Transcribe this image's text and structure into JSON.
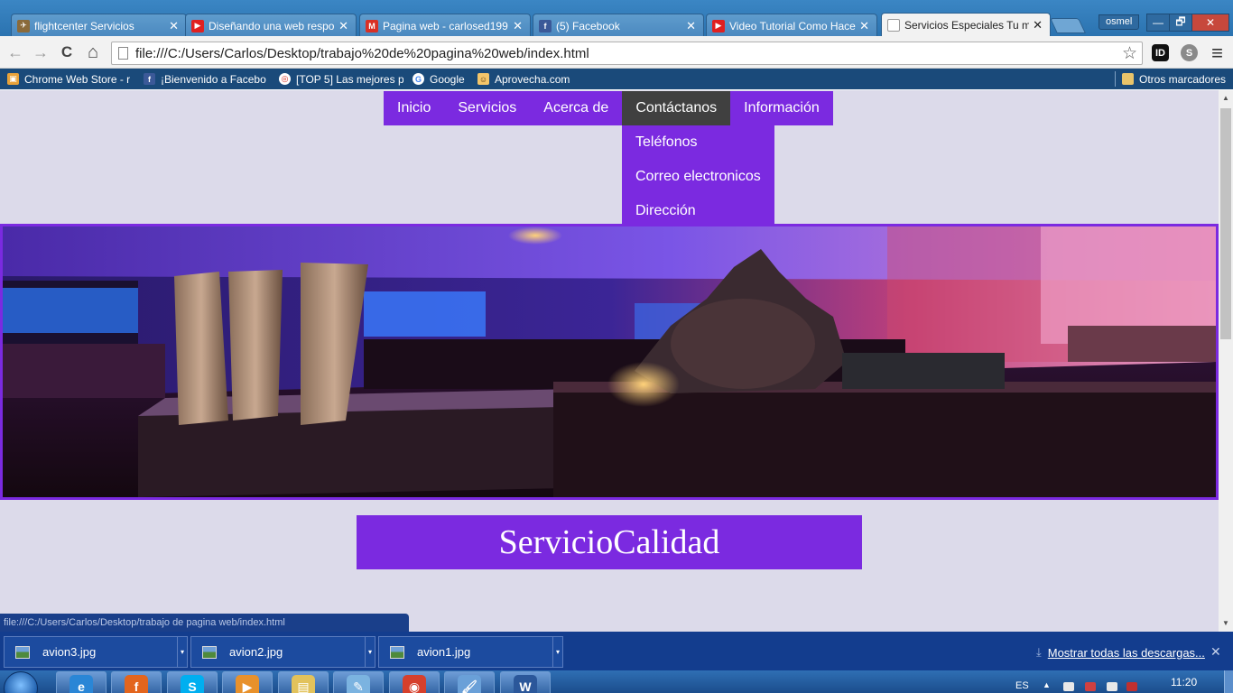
{
  "browser": {
    "tabs": [
      {
        "label": "flightcenter Servicios",
        "icon": "flightcenter-favicon",
        "active": false
      },
      {
        "label": "Diseñando una web respo",
        "icon": "youtube-icon",
        "active": false
      },
      {
        "label": "Pagina web - carlosed199",
        "icon": "gmail-icon",
        "active": false
      },
      {
        "label": "(5) Facebook",
        "icon": "facebook-icon",
        "active": false
      },
      {
        "label": "Video Tutorial Como Hace",
        "icon": "youtube-icon",
        "active": false
      },
      {
        "label": "Servicios Especiales Tu mu",
        "icon": "page-icon",
        "active": true
      }
    ],
    "tab_close": "✕",
    "user": "osmel",
    "window_controls": {
      "minimize": "—",
      "restore": "🗗",
      "close": "✕"
    },
    "nav": {
      "back": "←",
      "forward": "→",
      "reload": "C",
      "home": "⌂"
    },
    "url": "file:///C:/Users/Carlos/Desktop/trabajo%20de%20pagina%20web/index.html",
    "extensions": [
      {
        "name": "id-extension-icon",
        "label": "ID",
        "color": "#111111"
      },
      {
        "name": "skype-extension-icon",
        "label": "S",
        "color": "#8a8a8a"
      }
    ],
    "menu_glyph": "≡",
    "bookmarks": [
      {
        "label": "Chrome Web Store - r",
        "icon": "chrome-web-store-icon"
      },
      {
        "label": "¡Bienvenido a Facebo",
        "icon": "facebook-icon"
      },
      {
        "label": "[TOP 5] Las mejores p",
        "icon": "top5-icon"
      },
      {
        "label": "Google",
        "icon": "google-icon"
      },
      {
        "label": "Aprovecha.com",
        "icon": "aprovecha-icon"
      }
    ],
    "other_bookmarks": "Otros marcadores",
    "status_url": "file:///C:/Users/Carlos/Desktop/trabajo de pagina web/index.html"
  },
  "page": {
    "menu": [
      {
        "label": "Inicio",
        "active": false
      },
      {
        "label": "Servicios",
        "active": false
      },
      {
        "label": "Acerca de",
        "active": false
      },
      {
        "label": "Contáctanos",
        "active": true
      },
      {
        "label": "Información",
        "active": false
      }
    ],
    "submenu": [
      "Teléfonos",
      "Correo electronicos",
      "Dirección"
    ],
    "banner_subject": "restaurant-bar-interior-photo",
    "headline": "ServicioCalidad",
    "accent_color": "#7b2ae0",
    "background_color": "#dcdaea"
  },
  "downloads": {
    "items": [
      "avion3.jpg",
      "avion2.jpg",
      "avion1.jpg"
    ],
    "show_all": "Mostrar todas las descargas...",
    "close": "✕"
  },
  "taskbar": {
    "apps": [
      {
        "name": "internet-explorer-icon",
        "glyph": "e",
        "color": "#2a86d6"
      },
      {
        "name": "firefox-icon",
        "glyph": "f",
        "color": "#e3651d"
      },
      {
        "name": "skype-icon",
        "glyph": "S",
        "color": "#00aff0"
      },
      {
        "name": "media-player-icon",
        "glyph": "▶",
        "color": "#e8912b"
      },
      {
        "name": "file-explorer-icon",
        "glyph": "▤",
        "color": "#e2c25b"
      },
      {
        "name": "notepad-icon",
        "glyph": "✎",
        "color": "#7bb3e0"
      },
      {
        "name": "chrome-icon",
        "glyph": "◉",
        "color": "#d6402c"
      },
      {
        "name": "paint-icon",
        "glyph": "🖌",
        "color": "#6aa0d8"
      },
      {
        "name": "word-icon",
        "glyph": "W",
        "color": "#2b579a"
      }
    ],
    "language": "ES",
    "time": "11:20"
  }
}
